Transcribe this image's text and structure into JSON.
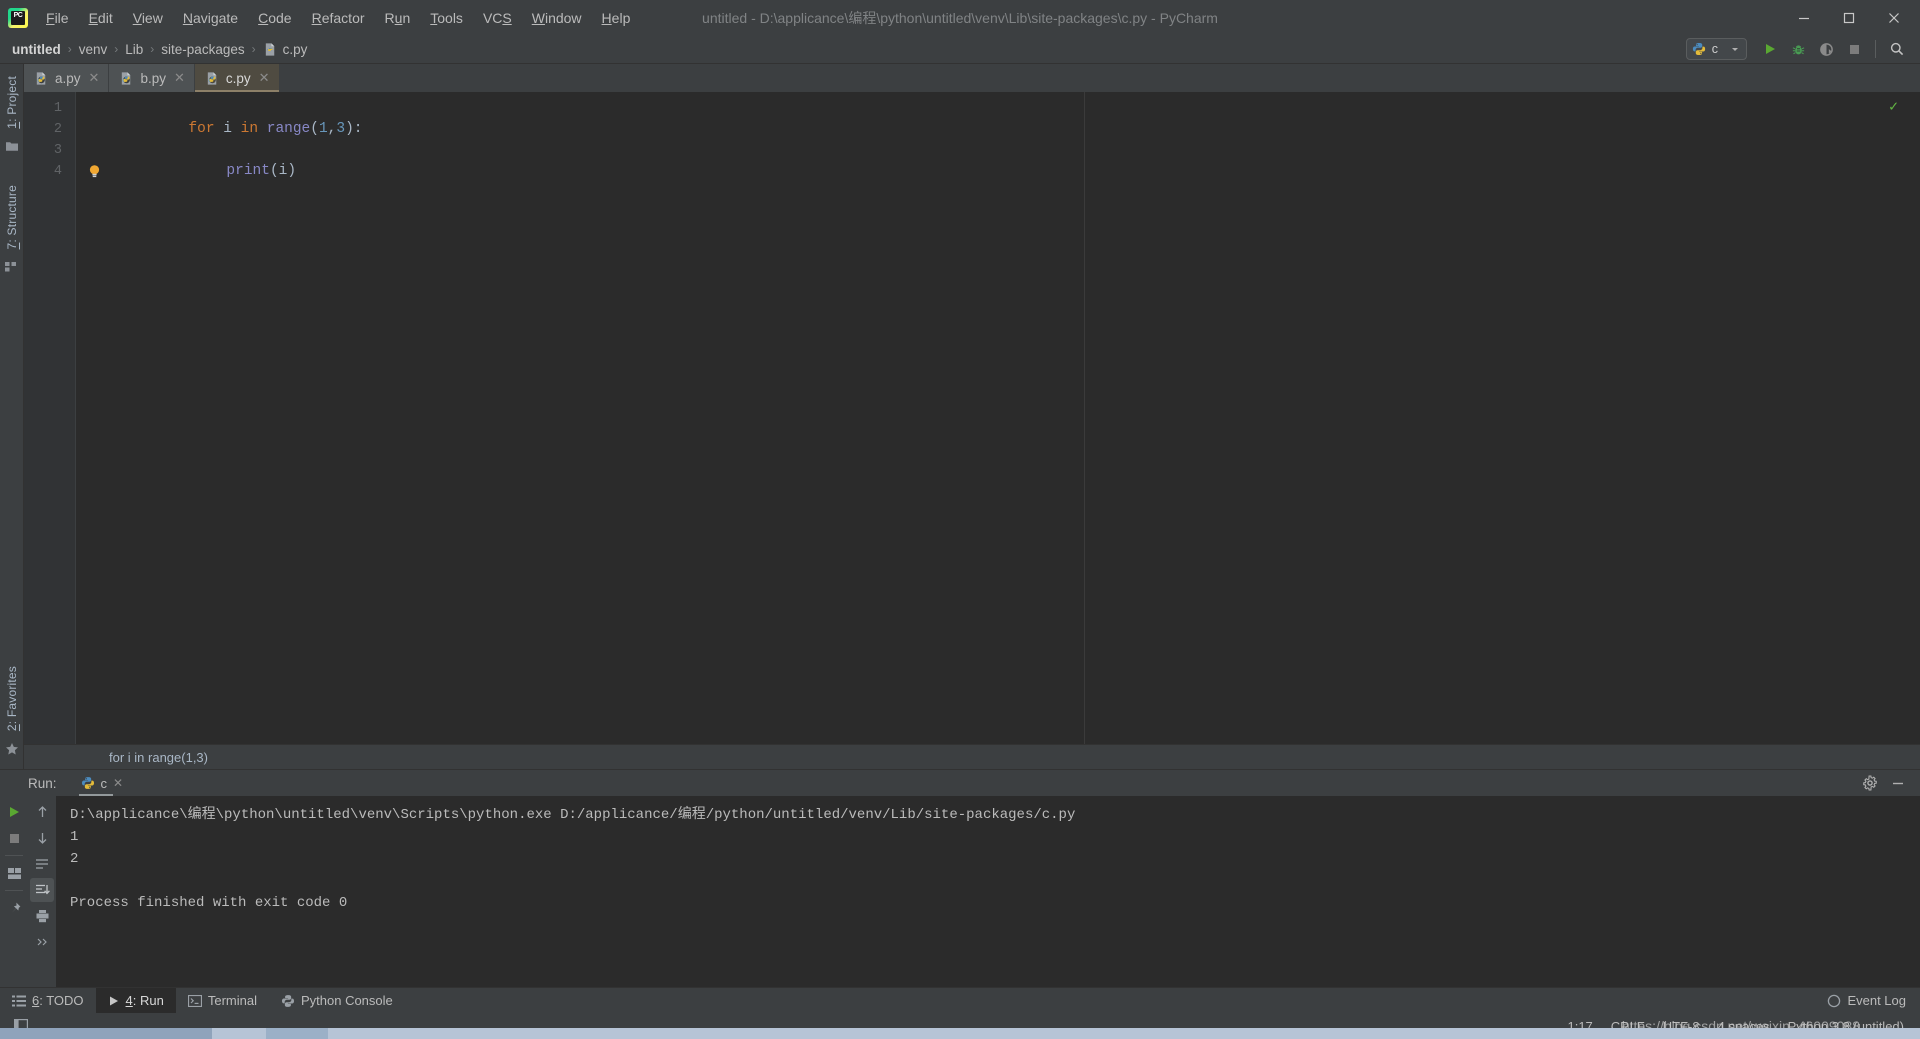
{
  "window": {
    "title": "untitled - D:\\applicance\\编程\\python\\untitled\\venv\\Lib\\site-packages\\c.py - PyCharm",
    "logo_text": "PC",
    "minimize": "—",
    "maximize": "❐",
    "close": "✕"
  },
  "menu": [
    {
      "pre": "",
      "hot": "F",
      "post": "ile"
    },
    {
      "pre": "",
      "hot": "E",
      "post": "dit"
    },
    {
      "pre": "",
      "hot": "V",
      "post": "iew"
    },
    {
      "pre": "",
      "hot": "N",
      "post": "avigate"
    },
    {
      "pre": "",
      "hot": "C",
      "post": "ode"
    },
    {
      "pre": "",
      "hot": "R",
      "post": "efactor"
    },
    {
      "pre": "R",
      "hot": "u",
      "post": "n"
    },
    {
      "pre": "",
      "hot": "T",
      "post": "ools"
    },
    {
      "pre": "VC",
      "hot": "S",
      "post": ""
    },
    {
      "pre": "",
      "hot": "W",
      "post": "indow"
    },
    {
      "pre": "",
      "hot": "H",
      "post": "elp"
    }
  ],
  "breadcrumb": {
    "items": [
      "untitled",
      "venv",
      "Lib",
      "site-packages",
      "c.py"
    ],
    "separator": "›"
  },
  "toolbar": {
    "run_config_name": "c",
    "run_title": "Run",
    "debug_title": "Debug",
    "coverage_title": "Run with Coverage",
    "stop_title": "Stop",
    "search_title": "Search Everywhere"
  },
  "left_rail": {
    "project_pre": "",
    "project_hot": "1",
    "project_post": ": Project",
    "structure_pre": "",
    "structure_hot": "7",
    "structure_post": ": Structure",
    "favorites_pre": "",
    "favorites_hot": "2",
    "favorites_post": ": Favorites"
  },
  "editor": {
    "tabs": [
      {
        "label": "a.py",
        "active": false
      },
      {
        "label": "b.py",
        "active": false
      },
      {
        "label": "c.py",
        "active": true
      }
    ],
    "close_glyph": "✕",
    "line_numbers": [
      "1",
      "2",
      "3",
      "4"
    ],
    "code": {
      "line1": {
        "kw1": "for",
        "var1": " i ",
        "kw2": "in",
        "fn": " range",
        "open": "(",
        "n1": "1",
        "comma": ",",
        "n2": "3",
        "close": ")",
        "colon": ":"
      },
      "line2": {
        "fn": "print",
        "open": "(",
        "arg": "i",
        "close": ")"
      }
    },
    "code_breadcrumb": "for i in range(1,3)",
    "inspection_ok": "✓"
  },
  "run_window": {
    "label": "Run:",
    "tab_name": "c",
    "close_glyph": "✕",
    "settings_title": "Settings",
    "hide_glyph": "—",
    "console_lines": [
      {
        "type": "cmd",
        "text": "D:\\applicance\\编程\\python\\untitled\\venv\\Scripts\\python.exe D:/applicance/编程/python/untitled/venv/Lib/site-packages/c.py"
      },
      {
        "type": "out",
        "text": "1"
      },
      {
        "type": "out",
        "text": "2"
      },
      {
        "type": "blank",
        "text": ""
      },
      {
        "type": "sys",
        "text": "Process finished with exit code 0"
      }
    ]
  },
  "bottom_tabs": [
    {
      "pre": "",
      "hot": "6",
      "post": ": TODO",
      "icon": "todo-icon",
      "active": false
    },
    {
      "pre": "",
      "hot": "4",
      "post": ": Run",
      "icon": "run-icon",
      "active": true
    },
    {
      "pre": "Terminal",
      "hot": "",
      "post": "",
      "icon": "terminal-icon",
      "active": false
    },
    {
      "pre": "Python Console",
      "hot": "",
      "post": "",
      "icon": "python-icon",
      "active": false
    }
  ],
  "bottom_right": {
    "event_log": "Event Log"
  },
  "statusbar": {
    "caret": "1:17",
    "line_sep": "CRLF",
    "encoding": "UTF-8",
    "indent": "4 spaces",
    "interpreter": "Python 3.8 (untitled)",
    "watermark": "https://blog.csdn.net/weixin_46009088"
  },
  "colors": {
    "accent_green": "#62b543",
    "keyword_orange": "#cc7832",
    "number_blue": "#6897bb",
    "function_purple": "#8888c6",
    "text": "#a9b7c6",
    "chrome_bg": "#3c3f41",
    "editor_bg": "#2b2b2b"
  }
}
